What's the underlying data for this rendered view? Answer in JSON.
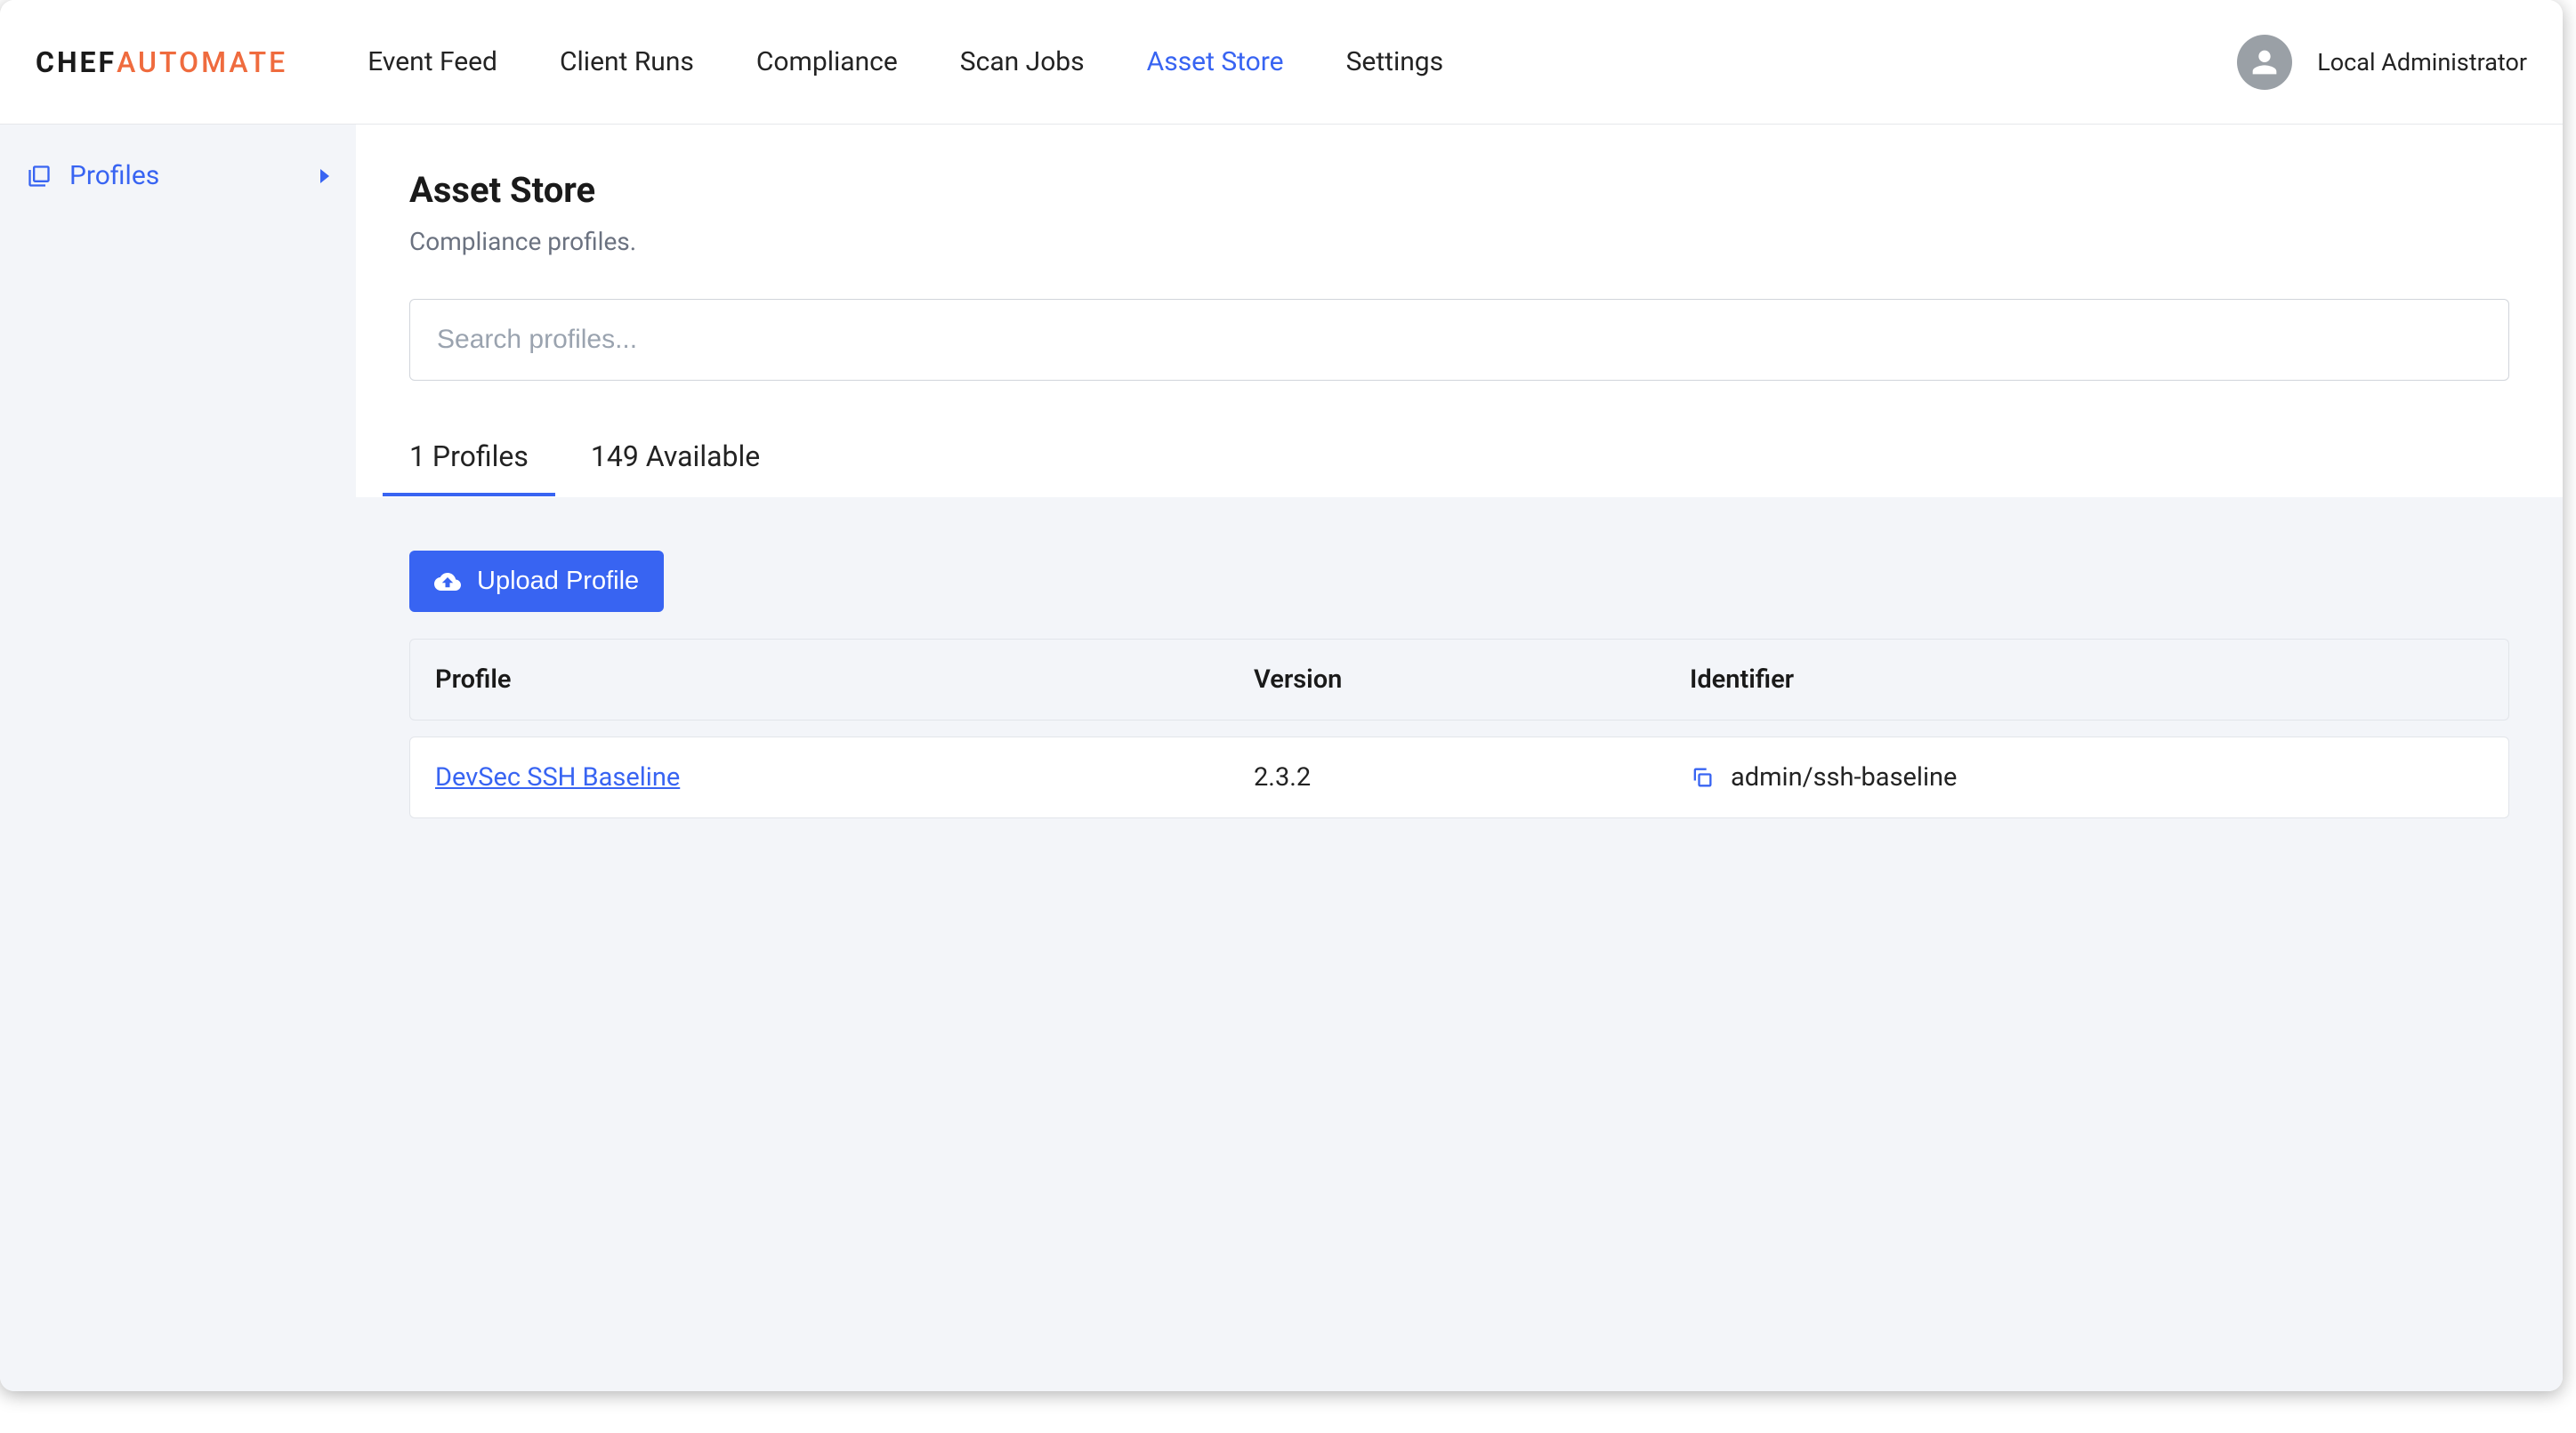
{
  "brand": {
    "chef": "CHEF",
    "automate": "AUTOMATE"
  },
  "nav": {
    "items": [
      {
        "label": "Event Feed",
        "active": false
      },
      {
        "label": "Client Runs",
        "active": false
      },
      {
        "label": "Compliance",
        "active": false
      },
      {
        "label": "Scan Jobs",
        "active": false
      },
      {
        "label": "Asset Store",
        "active": true
      },
      {
        "label": "Settings",
        "active": false
      }
    ]
  },
  "user": {
    "name": "Local Administrator"
  },
  "sidebar": {
    "items": [
      {
        "icon": "library-icon",
        "label": "Profiles",
        "active": true
      }
    ]
  },
  "page": {
    "title": "Asset Store",
    "subtitle": "Compliance profiles."
  },
  "search": {
    "placeholder": "Search profiles..."
  },
  "tabs": [
    {
      "label": "1 Profiles",
      "active": true
    },
    {
      "label": "149 Available",
      "active": false
    }
  ],
  "upload": {
    "label": "Upload Profile"
  },
  "table": {
    "columns": {
      "profile": "Profile",
      "version": "Version",
      "identifier": "Identifier"
    },
    "rows": [
      {
        "profile": "DevSec SSH Baseline",
        "version": "2.3.2",
        "identifier": "admin/ssh-baseline"
      }
    ]
  }
}
